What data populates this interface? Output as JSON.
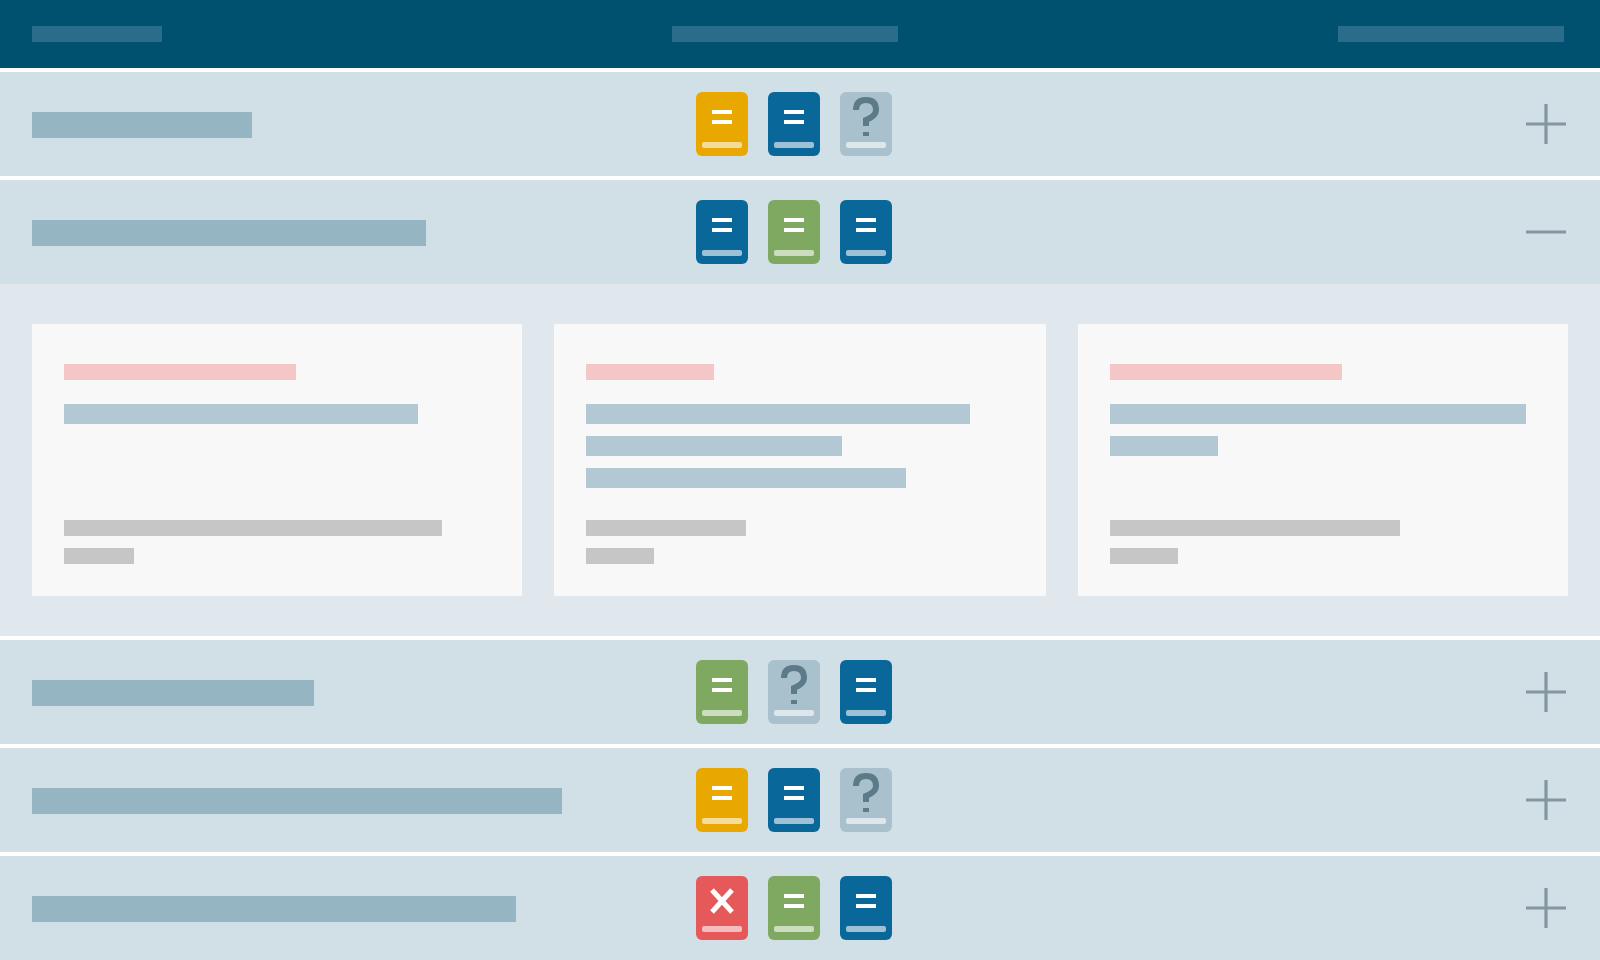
{
  "rows": [
    {
      "expanded": false,
      "books": [
        {
          "kind": "book",
          "color": "#e8a800"
        },
        {
          "kind": "book",
          "color": "#0a679a"
        },
        {
          "kind": "unknown",
          "color": "#a9c1cc"
        }
      ]
    },
    {
      "expanded": true,
      "books": [
        {
          "kind": "book",
          "color": "#0a679a"
        },
        {
          "kind": "book",
          "color": "#7fa960"
        },
        {
          "kind": "book",
          "color": "#0a679a"
        }
      ],
      "cards": [
        {
          "kind": "one-line"
        },
        {
          "kind": "three-line"
        },
        {
          "kind": "two-line"
        }
      ]
    },
    {
      "expanded": false,
      "books": [
        {
          "kind": "book",
          "color": "#7fa960"
        },
        {
          "kind": "unknown",
          "color": "#a9c1cc"
        },
        {
          "kind": "book",
          "color": "#0a679a"
        }
      ]
    },
    {
      "expanded": false,
      "books": [
        {
          "kind": "book",
          "color": "#e8a800"
        },
        {
          "kind": "book",
          "color": "#0a679a"
        },
        {
          "kind": "unknown",
          "color": "#a9c1cc"
        }
      ]
    },
    {
      "expanded": false,
      "books": [
        {
          "kind": "error",
          "color": "#e5595b"
        },
        {
          "kind": "book",
          "color": "#7fa960"
        },
        {
          "kind": "book",
          "color": "#0a679a"
        }
      ]
    }
  ]
}
